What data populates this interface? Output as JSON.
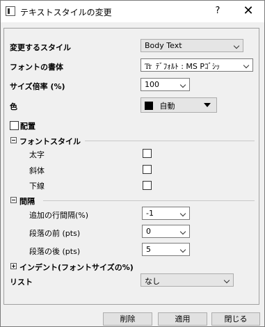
{
  "window": {
    "title": "テキストスタイルの変更",
    "help": "?",
    "close": "✕"
  },
  "fields": {
    "style_label": "変更するスタイル",
    "style_value": "Body Text",
    "font_label": "フォントの書体",
    "font_icon": "Tт",
    "font_value": "ﾃﾞﾌｫﾙﾄ : MS Pｺﾞｼｯ",
    "size_label": "サイズ倍率 (%)",
    "size_value": "100",
    "color_label": "色",
    "color_value": "自動",
    "color_swatch": "#000000",
    "align_label": "配置"
  },
  "font_style": {
    "header": "フォントスタイル",
    "bold": "太字",
    "italic": "斜体",
    "underline": "下線"
  },
  "spacing": {
    "header": "間隔",
    "line_label": "追加の行間隔(%)",
    "line_value": "-1",
    "before_label": "段落の前 (pts)",
    "before_value": "0",
    "after_label": "段落の後 (pts)",
    "after_value": "5"
  },
  "indent": {
    "header": "インデント(フォントサイズの%)"
  },
  "list": {
    "label": "リスト",
    "value": "なし"
  },
  "buttons": {
    "delete": "削除",
    "apply": "適用",
    "close": "閉じる"
  }
}
